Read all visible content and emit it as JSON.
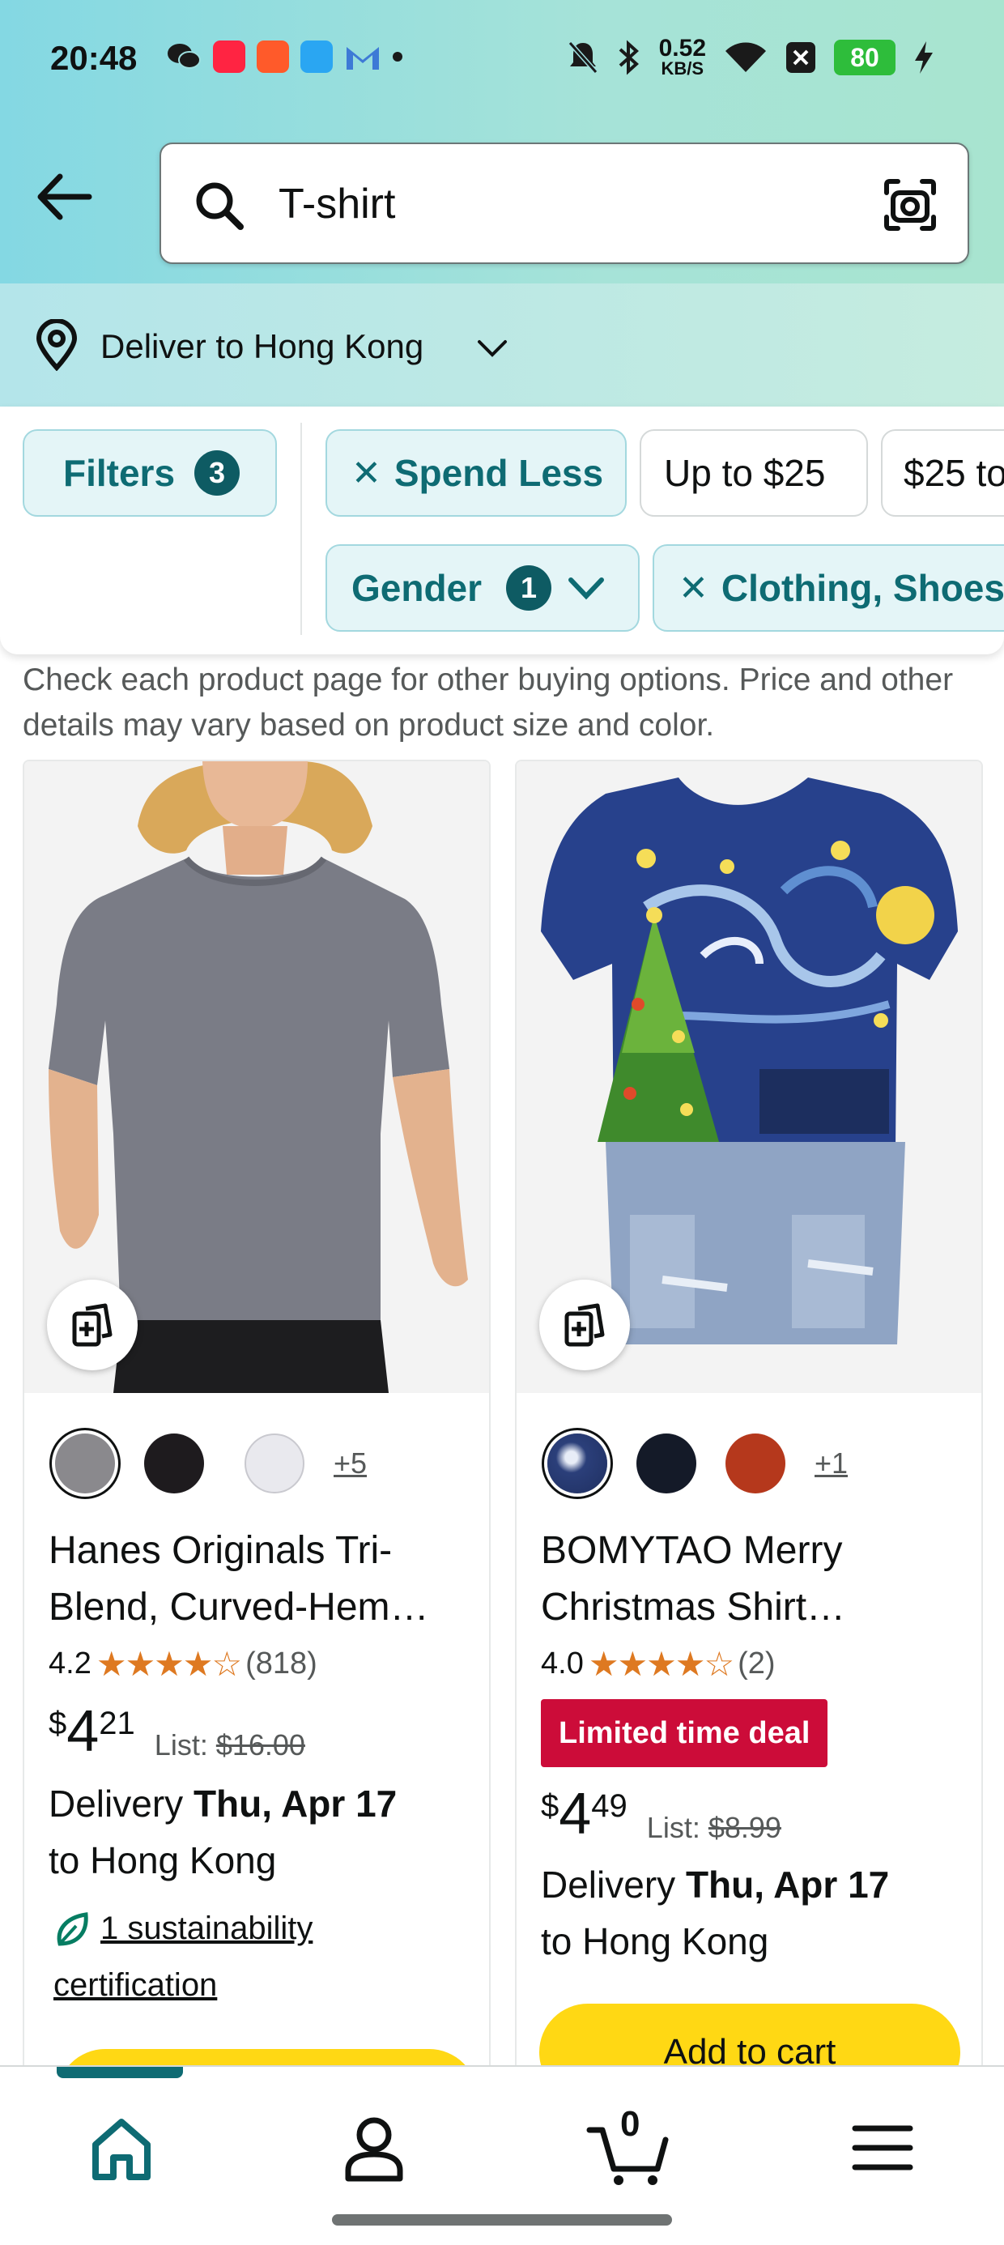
{
  "status_bar": {
    "time": "20:48",
    "net_speed_value": "0.52",
    "net_speed_unit": "KB/S",
    "battery": "80"
  },
  "search": {
    "query": "T-shirt"
  },
  "location": {
    "deliver_label": "Deliver to Hong Kong"
  },
  "filters": {
    "filters_label": "Filters",
    "filters_count": "3",
    "spend_less": "Spend Less",
    "price_1": "Up to $25",
    "price_2": "$25 to",
    "gender_label": "Gender",
    "gender_count": "1",
    "category": "Clothing, Shoes"
  },
  "notice": "Check each product page for other buying options. Price and other details may vary based on product size and color.",
  "products": [
    {
      "more_colors": "+5",
      "swatch_colors": [
        "#8a898d",
        "#1e1b1e",
        "#e9e9ee"
      ],
      "title": "Hanes Originals Tri-Blend, Curved-Hem…",
      "rating": "4.2",
      "stars": "★★★★☆",
      "rating_count": "(818)",
      "price_symbol": "$",
      "price_whole": "4",
      "price_fraction": "21",
      "list_label": "List:",
      "list_price": "$16.00",
      "delivery_prefix": "Delivery",
      "delivery_date": "Thu, Apr 17",
      "delivery_suffix": "to Hong Kong",
      "sustainability": "1 sustainability certification"
    },
    {
      "more_colors": "+1",
      "swatch_colors": [
        "#2b3f7a",
        "#141a28",
        "#b5381c"
      ],
      "title": "BOMYTAO Merry Christmas Shirt…",
      "rating": "4.0",
      "stars": "★★★★☆",
      "rating_count": "(2)",
      "deal_badge": "Limited time deal",
      "price_symbol": "$",
      "price_whole": "4",
      "price_fraction": "49",
      "list_label": "List:",
      "list_price": "$8.99",
      "delivery_prefix": "Delivery",
      "delivery_date": "Thu, Apr 17",
      "delivery_suffix": "to Hong Kong",
      "add_to_cart": "Add to cart"
    }
  ],
  "bottom_nav": {
    "cart_count": "0",
    "accent_color": "#0e6b73"
  },
  "colors": {
    "add_to_cart": "#ffd814",
    "deal_badge": "#cc0c39",
    "star": "#de7921"
  }
}
